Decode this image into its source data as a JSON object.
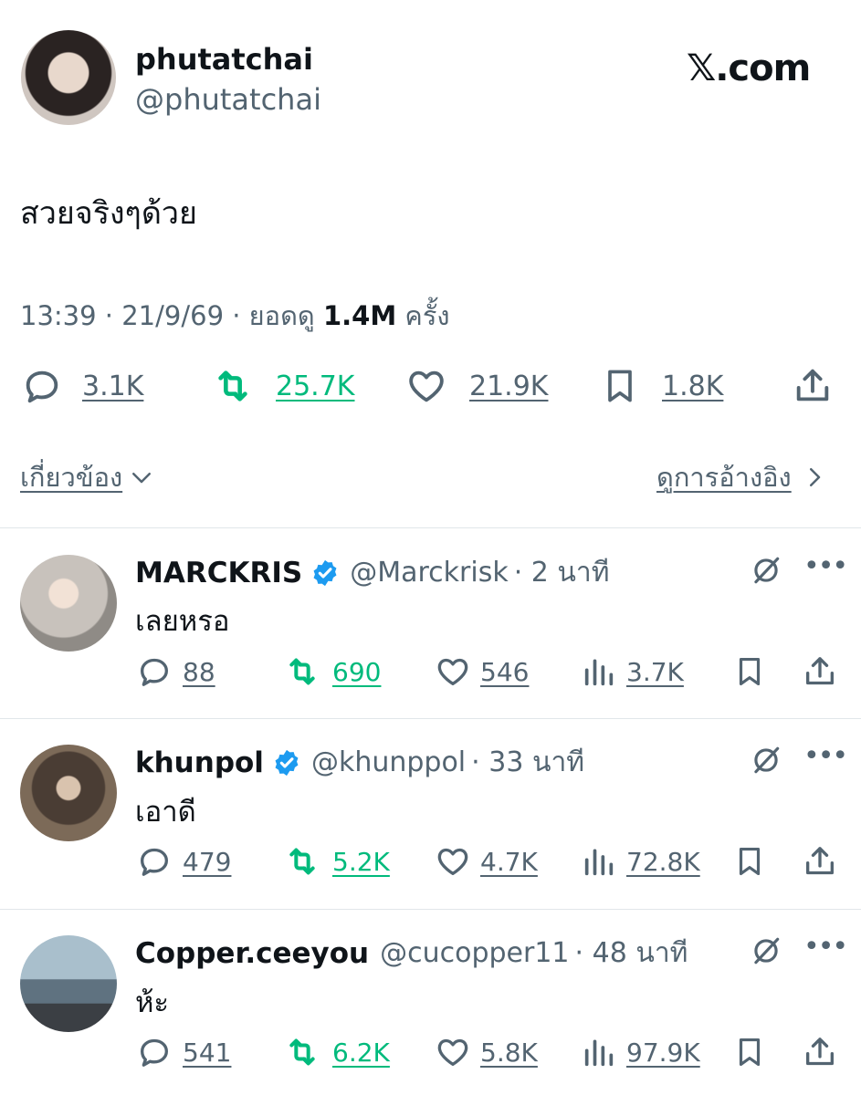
{
  "tweet": {
    "display_name": "phutatchai",
    "handle": "@phutatchai",
    "brand": "𝕏.com",
    "text": "สวยจริงๆด้วย",
    "time": "13:39 · 21/9/69 · ยอดดู ",
    "views": "1.4M",
    "views_suffix": " ครั้ง",
    "stats": {
      "replies": "3.1K",
      "reposts": "25.7K",
      "likes": "21.9K",
      "bookmarks": "1.8K"
    },
    "relevant_label": "เกี่ยวข้อง",
    "view_quotes_label": "ดูการอ้างอิง"
  },
  "replies": [
    {
      "display_name": "MARCKRIS",
      "handle": "@Marckrisk",
      "time": "· 2 นาที",
      "text": "เลยหรอ",
      "replies": "88",
      "reposts": "690",
      "likes": "546",
      "views": "3.7K"
    },
    {
      "display_name": "khunpol",
      "handle": "@khunppol",
      "time": "· 33 นาที",
      "text": "เอาดี",
      "replies": "479",
      "reposts": "5.2K",
      "likes": "4.7K",
      "views": "72.8K"
    },
    {
      "display_name": "Copper.ceeyou",
      "handle": "@cucopper11",
      "time": "· 48 นาที",
      "text": "ห้ะ",
      "replies": "541",
      "reposts": "6.2K",
      "likes": "5.8K",
      "views": "97.9K"
    }
  ],
  "colors": {
    "accent_green": "#00ba7c",
    "verified_blue": "#1d9bf0",
    "muted": "#536471"
  }
}
